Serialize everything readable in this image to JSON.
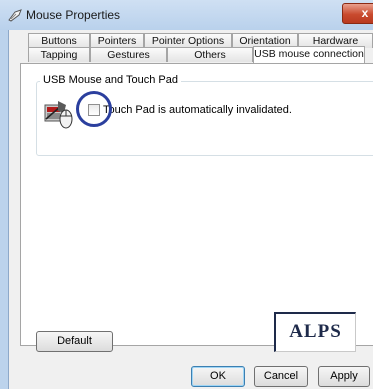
{
  "window": {
    "title": "Mouse Properties",
    "close_label": "x"
  },
  "tabs": {
    "row_back": [
      "Buttons",
      "Pointers",
      "Pointer Options",
      "Orientation",
      "Hardware"
    ],
    "row_front": [
      "Tapping",
      "Gestures",
      "Others",
      "USB mouse connection"
    ],
    "active": "USB mouse connection"
  },
  "group": {
    "label": "USB Mouse and Touch Pad",
    "checkbox_label": "Touch Pad is automatically invalidated.",
    "checkbox_checked": false
  },
  "logo": {
    "text": "ALPS"
  },
  "buttons": {
    "default_label": "Default",
    "ok_label": "OK",
    "cancel_label": "Cancel",
    "apply_label": "Apply"
  },
  "colors": {
    "highlight_ring": "#2b3f9e",
    "title_bar": "#bcd3ec",
    "logo": "#1e2a4a"
  }
}
